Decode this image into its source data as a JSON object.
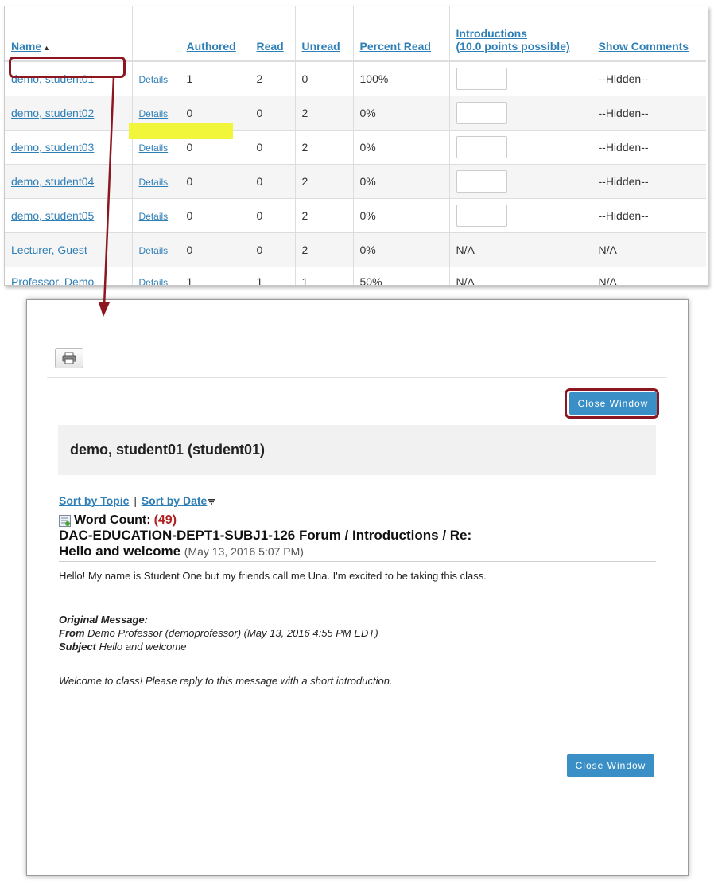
{
  "table": {
    "headers": {
      "name": "Name",
      "authored": "Authored",
      "read": "Read",
      "unread": "Unread",
      "percent_read": "Percent Read",
      "introductions_line1": "Introductions",
      "introductions_line2": "(10.0 points possible)",
      "show_comments": "Show Comments"
    },
    "rows": [
      {
        "name": "demo, student01",
        "details": "Details",
        "authored": "1",
        "read": "2",
        "unread": "0",
        "percent": "100%",
        "intro": "",
        "comments": "--Hidden--"
      },
      {
        "name": "demo, student02",
        "details": "Details",
        "authored": "0",
        "read": "0",
        "unread": "2",
        "percent": "0%",
        "intro": "",
        "comments": "--Hidden--"
      },
      {
        "name": "demo, student03",
        "details": "Details",
        "authored": "0",
        "read": "0",
        "unread": "2",
        "percent": "0%",
        "intro": "",
        "comments": "--Hidden--"
      },
      {
        "name": "demo, student04",
        "details": "Details",
        "authored": "0",
        "read": "0",
        "unread": "2",
        "percent": "0%",
        "intro": "",
        "comments": "--Hidden--"
      },
      {
        "name": "demo, student05",
        "details": "Details",
        "authored": "0",
        "read": "0",
        "unread": "2",
        "percent": "0%",
        "intro": "",
        "comments": "--Hidden--"
      },
      {
        "name": "Lecturer, Guest",
        "details": "Details",
        "authored": "0",
        "read": "0",
        "unread": "2",
        "percent": "0%",
        "intro": "N/A",
        "comments": "N/A"
      },
      {
        "name": "Professor, Demo",
        "details": "Details",
        "authored": "1",
        "read": "1",
        "unread": "1",
        "percent": "50%",
        "intro": "N/A",
        "comments": "N/A"
      }
    ]
  },
  "popup": {
    "close_label": "Close Window",
    "student_name": "demo, student01 (student01)",
    "sort_by_topic": "Sort by Topic",
    "sort_separator": "|",
    "sort_by_date": "Sort by Date",
    "word_count_label": "Word Count:",
    "word_count_value": "(49)",
    "message_title_line1": "DAC-EDUCATION-DEPT1-SUBJ1-126 Forum / Introductions / Re:",
    "message_title_line2": "Hello and welcome",
    "message_date": "(May 13, 2016 5:07 PM)",
    "message_body": "Hello! My name is Student One but my friends call me Una. I'm excited to be taking this class.",
    "original_message_label": "Original Message:",
    "from_label": "From",
    "from_value": "Demo Professor (demoprofessor) (May 13, 2016 4:55 PM EDT)",
    "subject_label": "Subject",
    "subject_value": "Hello and welcome",
    "original_body": "Welcome to class! Please reply to this message with a short introduction."
  },
  "colors": {
    "link": "#2f7fb7",
    "callout": "#8c1720",
    "button": "#3a8fc6",
    "highlight": "#f2f63a",
    "word_count": "#b22222"
  },
  "icons": {
    "print": "printer-icon",
    "sort": "sort-arrow-icon",
    "word_count": "word-count-icon"
  }
}
